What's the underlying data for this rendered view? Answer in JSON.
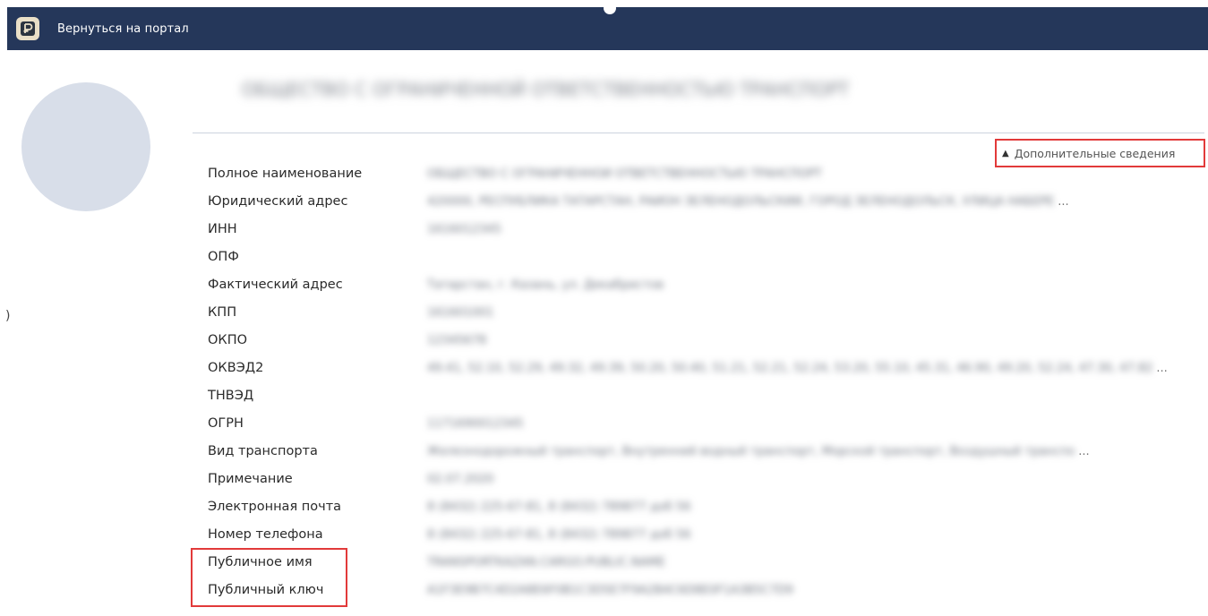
{
  "header": {
    "logo_icon": "ruble-icon",
    "portal_link": "Вернуться на портал"
  },
  "organization": {
    "title": "ОБЩЕСТВО С ОГРАНИЧЕННОЙ ОТВЕТСТВЕННОСТЬЮ ТРАНСПОРТ"
  },
  "extra_info": {
    "label": "Дополнительные сведения",
    "icon": "chevron-up-icon"
  },
  "fields": [
    {
      "label": "Полное наименование",
      "value": "ОБЩЕСТВО С ОГРАНИЧЕННОЙ ОТВЕТСТВЕННОСТЬЮ ТРАНСПОРТ",
      "truncated": false
    },
    {
      "label": "Юридический адрес",
      "value": "420000, РЕСПУБЛИКА ТАТАРСТАН, РАЙОН ЗЕЛЕНОДОЛЬСКИЙ, ГОРОД ЗЕЛЕНОДОЛЬСК, УЛИЦА НАБЕРЕ",
      "truncated": true
    },
    {
      "label": "ИНН",
      "value": "1616012345",
      "truncated": false
    },
    {
      "label": "ОПФ",
      "value": "",
      "truncated": false
    },
    {
      "label": "Фактический адрес",
      "value": "Татарстан, г. Казань, ул. Декабристов",
      "truncated": false
    },
    {
      "label": "КПП",
      "value": "161601001",
      "truncated": false
    },
    {
      "label": "ОКПО",
      "value": "12345678",
      "truncated": false
    },
    {
      "label": "ОКВЭД2",
      "value": "49.41, 52.10, 52.29, 49.32, 49.39, 50.20, 50.40, 51.21, 52.21, 52.24, 53.20, 55.10, 45.31, 46.90, 49.20, 52.24, 47.30, 47.82",
      "truncated": true
    },
    {
      "label": "ТНВЭД",
      "value": "",
      "truncated": false
    },
    {
      "label": "ОГРН",
      "value": "1171690012345",
      "truncated": false
    },
    {
      "label": "Вид транспорта",
      "value": "Железнодорожный транспорт, Внутренний водный транспорт, Морской транспорт, Воздушный транспо",
      "truncated": true
    },
    {
      "label": "Примечание",
      "value": "02.07.2020",
      "truncated": false
    },
    {
      "label": "Электронная почта",
      "value": "8 (8432) 225-67-81, 8 (8432) 789877 доб 56",
      "truncated": false
    },
    {
      "label": "Номер телефона",
      "value": "8 (8432) 225-67-81, 8 (8432) 789877 доб 56",
      "truncated": false
    },
    {
      "label": "Публичное имя",
      "value": "TRANSPORTKAZAN.CARGO.PUBLIC.NAME",
      "truncated": false
    },
    {
      "label": "Публичный ключ",
      "value": "A1F3E9B7C4D2A8E6F0B1C3D5E7F9A2B4C6D8E0F1A3B5C7D9",
      "truncated": false
    }
  ],
  "ellipsis": "...",
  "edge_mark": ")"
}
